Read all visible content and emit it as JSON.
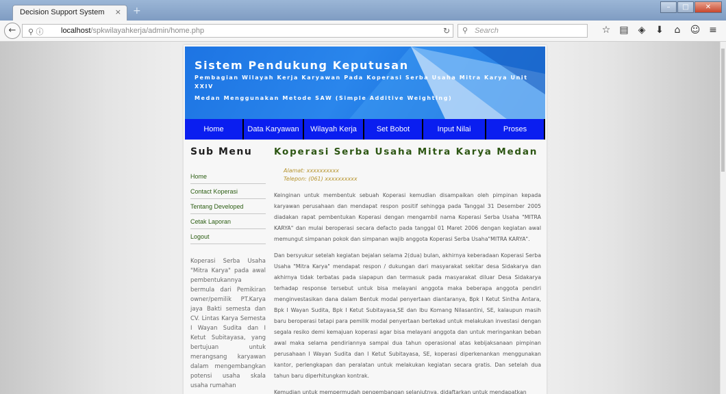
{
  "browser": {
    "tab_title": "Decision Support System",
    "tab_close": "×",
    "new_tab": "+",
    "url_host": "localhost",
    "url_path": "/spkwilayahkerja/admin/home.php",
    "search_placeholder": "Search",
    "icons": [
      "star-icon",
      "reading-list-icon",
      "pocket-icon",
      "download-icon",
      "home-icon",
      "chat-icon",
      "menu-icon"
    ]
  },
  "header": {
    "title": "Sistem Pendukung Keputusan",
    "subtitle_line1": "Pembagian Wilayah Kerja Karyawan Pada Koperasi Serba Usaha Mitra Karya Unit XXIV",
    "subtitle_line2": "Medan Menggunakan Metode SAW (Simple Additive Weighting)"
  },
  "menu": {
    "items": [
      "Home",
      "Data Karyawan",
      "Wilayah Kerja",
      "Set Bobot",
      "Input Nilai",
      "Proses"
    ]
  },
  "sidebar": {
    "title": "Sub Menu",
    "items": [
      "Home",
      "Contact Koperasi",
      "Tentang Developed",
      "Cetak Laporan",
      "Logout"
    ],
    "text": "Koperasi Serba Usaha \"Mitra Karya\" pada awal pembentukannya bermula dari Pemikiran owner/pemilik PT.Karya jaya Bakti semesta dan CV. Lintas Karya Semesta I Wayan Sudita dan I Ketut Subitayasa, yang bertujuan untuk merangsang karyawan dalam mengembangkan potensi usaha skala usaha rumahan"
  },
  "main": {
    "title": "Koperasi Serba Usaha Mitra Karya Medan",
    "address": "Alamat: xxxxxxxxxx",
    "phone": "Telepon: (061) xxxxxxxxxx",
    "paragraphs": [
      "Keinginan untuk membentuk sebuah Koperasi kemudian disampaikan oleh pimpinan kepada karyawan perusahaan dan mendapat respon positif sehingga pada Tanggal 31 Desember 2005 diadakan rapat pembentukan Koperasi dengan mengambil nama Koperasi Serba Usaha \"MITRA KARYA\" dan mulai beroperasi secara defacto pada tanggal 01 Maret 2006 dengan kegiatan awal memungut simpanan pokok dan simpanan wajib anggota Koperasi Serba Usaha\"MITRA KARYA\".",
      "Dan bersyukur setelah kegiatan bejalan selama 2(dua) bulan, akhirnya keberadaan Koperasi Serba Usaha \"Mitra Karya\" mendapat respon / dukungan dari masyarakat sekitar desa Sidakarya dan akhirnya tidak terbatas pada siapapun dan termasuk pada masyarakat diluar Desa Sidakarya terhadap response tersebut untuk bisa melayani anggota maka beberapa anggota pendiri menginvestasikan dana dalam Bentuk modal penyertaan diantaranya, Bpk I Ketut Sintha Antara, Bpk I Wayan Sudita, Bpk I Ketut Subitayasa,SE dan Ibu Komang Nilasantini, SE, kalaupun masih baru beroperasi tetapi para pemilik modal penyertaan bertekad untuk melakukan investasi dengan segala resiko demi kemajuan koperasi agar bisa melayani anggota dan untuk meringankan beban awal maka selama pendiriannya sampai dua tahun operasional atas kebijaksanaan pimpinan perusahaan I Wayan Sudita dan I Ketut Subitayasa, SE, koperasi diperkenankan menggunakan kantor, perlengkapan dan peralatan untuk melakukan kegiatan secara gratis. Dan setelah dua tahun baru diperhitungkan kontrak.",
      "Kemudian untuk mempermudah pengembangan selanjutnya, didaftarkan untuk mendapatkan"
    ]
  },
  "colors": {
    "menu_bg": "#0a1ef0",
    "header_blue": "#1d74e3",
    "title_green": "#2d5613",
    "link_green": "#2b5d12",
    "address_gold": "#b5922a"
  }
}
